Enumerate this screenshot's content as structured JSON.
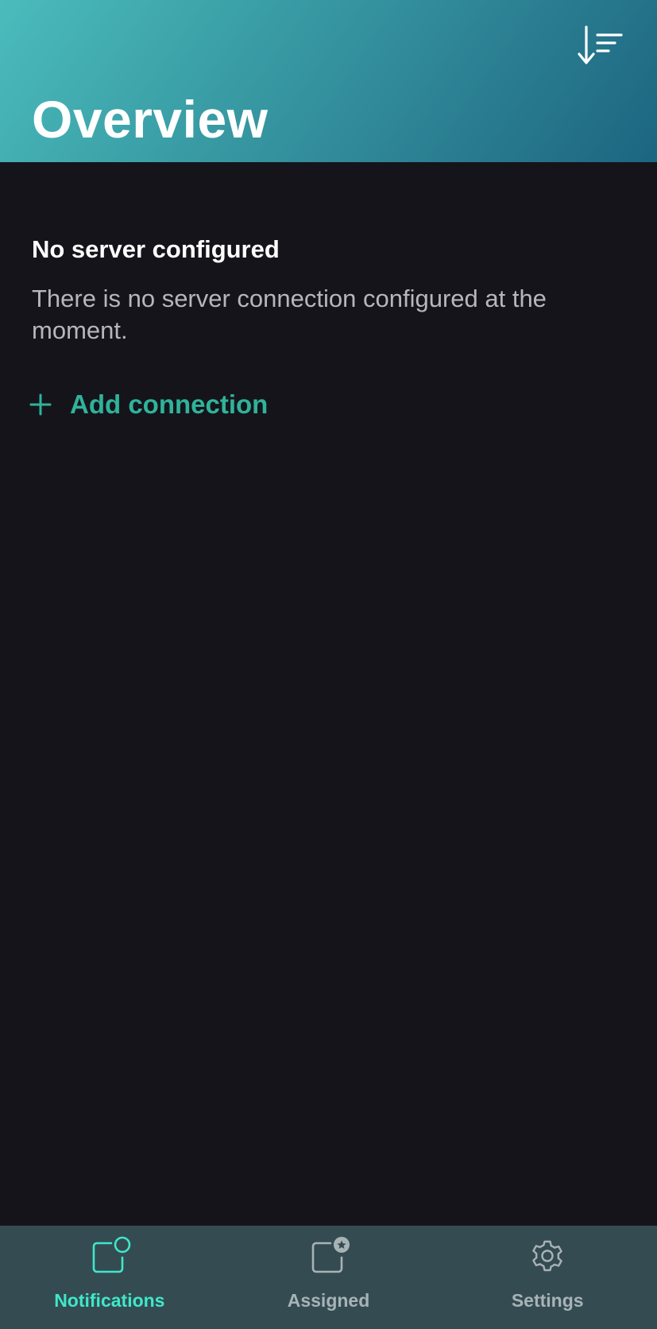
{
  "header": {
    "title": "Overview",
    "sort_icon": "sort-descending-icon"
  },
  "main": {
    "empty_state": {
      "title": "No server configured",
      "description": "There is no server connection configured at the moment.",
      "action_icon": "plus-icon",
      "action_label": "Add connection"
    }
  },
  "bottom_nav": {
    "items": [
      {
        "label": "Notifications",
        "icon": "notification-icon",
        "active": true
      },
      {
        "label": "Assigned",
        "icon": "assigned-star-icon",
        "active": false
      },
      {
        "label": "Settings",
        "icon": "gear-icon",
        "active": false
      }
    ]
  },
  "colors": {
    "accent": "#2fb39b",
    "active_nav": "#3fe8c8",
    "background": "#16141b",
    "nav_background": "#344b52"
  }
}
